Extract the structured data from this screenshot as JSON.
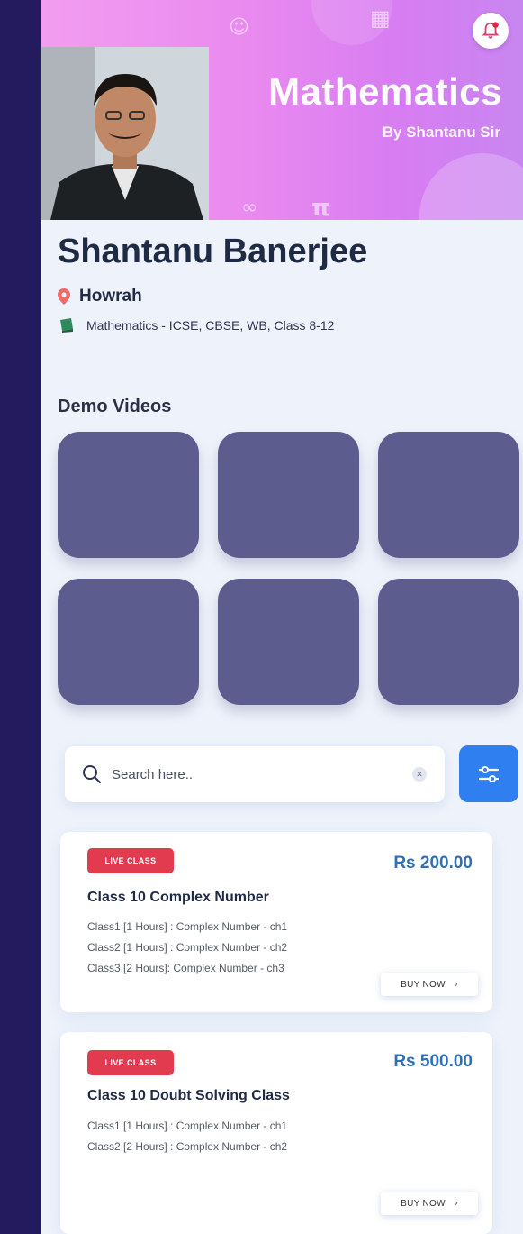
{
  "banner": {
    "title": "Mathematics",
    "subtitle": "By Shantanu Sir"
  },
  "profile": {
    "name": "Shantanu Banerjee",
    "location": "Howrah",
    "subjects": "Mathematics - ICSE, CBSE, WB, Class 8-12"
  },
  "demo": {
    "title": "Demo Videos",
    "tile_count": 6
  },
  "search": {
    "placeholder": "Search here..",
    "value": ""
  },
  "courses": [
    {
      "badge": "LIVE CLASS",
      "price": "Rs 200.00",
      "title": "Class 10 Complex Number",
      "lines": [
        "Class1 [1 Hours] : Complex Number - ch1",
        "Class2 [1 Hours] : Complex Number - ch2",
        "Class3 [2 Hours]: Complex Number - ch3"
      ],
      "button": "BUY NOW"
    },
    {
      "badge": "LIVE CLASS",
      "price": "Rs 500.00",
      "title": "Class 10 Doubt Solving Class",
      "lines": [
        "Class1 [1 Hours] : Complex Number - ch1",
        "Class2 [2 Hours] : Complex Number - ch2"
      ],
      "button": "BUY NOW"
    }
  ],
  "icons": {
    "bell": "bell-icon",
    "location": "location-pin-icon",
    "book": "book-icon",
    "search": "search-icon",
    "clear": "clear-icon",
    "filter": "filter-sliders-icon",
    "chevron": "chevron-right-icon"
  },
  "colors": {
    "background": "#241a5e",
    "banner_pink": "#e889ef",
    "tile": "#5c5d8e",
    "badge": "#e23a4e",
    "price": "#2f6fb8",
    "filter": "#2f7ff0"
  }
}
